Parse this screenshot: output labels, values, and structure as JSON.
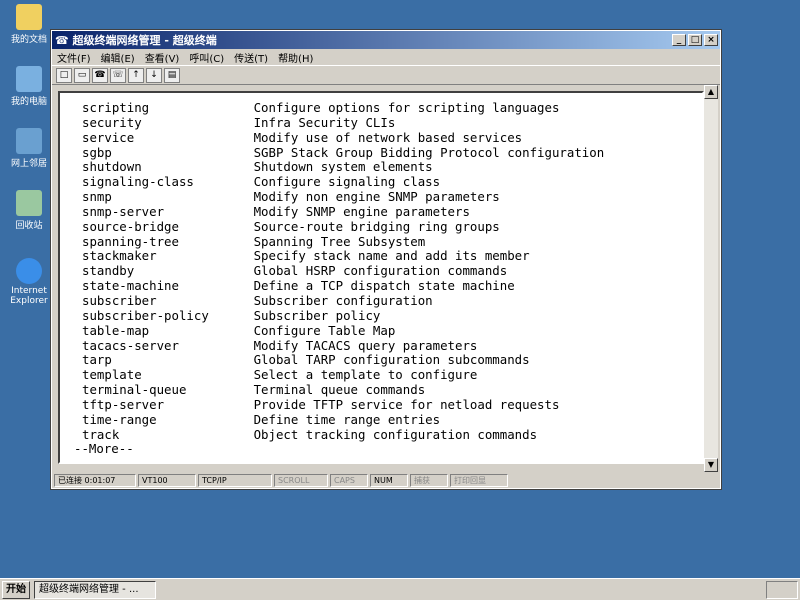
{
  "desktop": {
    "icons": [
      {
        "label": "我的文档",
        "icon": "folder-icon"
      },
      {
        "label": "我的电脑",
        "icon": "computer-icon"
      },
      {
        "label": "网上邻居",
        "icon": "network-icon"
      },
      {
        "label": "回收站",
        "icon": "recycle-bin-icon"
      },
      {
        "label": "Internet Explorer",
        "icon": "ie-icon"
      }
    ]
  },
  "window": {
    "title": "超级终端网络管理 - 超级终端",
    "menu": [
      "文件(F)",
      "编辑(E)",
      "查看(V)",
      "呼叫(C)",
      "传送(T)",
      "帮助(H)"
    ],
    "terminal": {
      "lines": [
        "scripting              Configure options for scripting languages",
        "security               Infra Security CLIs",
        "service                Modify use of network based services",
        "sgbp                   SGBP Stack Group Bidding Protocol configuration",
        "shutdown               Shutdown system elements",
        "signaling-class        Configure signaling class",
        "snmp                   Modify non engine SNMP parameters",
        "snmp-server            Modify SNMP engine parameters",
        "source-bridge          Source-route bridging ring groups",
        "spanning-tree          Spanning Tree Subsystem",
        "stackmaker             Specify stack name and add its member",
        "standby                Global HSRP configuration commands",
        "state-machine          Define a TCP dispatch state machine",
        "subscriber             Subscriber configuration",
        "subscriber-policy      Subscriber policy",
        "table-map              Configure Table Map",
        "tacacs-server          Modify TACACS query parameters",
        "tarp                   Global TARP configuration subcommands",
        "template               Select a template to configure",
        "terminal-queue         Terminal queue commands",
        "tftp-server            Provide TFTP service for netload requests",
        "time-range             Define time range entries",
        "track                  Object tracking configuration commands"
      ],
      "more": "--More--"
    },
    "status": {
      "connected": "已连接 0:01:07",
      "emulation": "VT100",
      "protocol": "TCP/IP",
      "scroll": "SCROLL",
      "caps": "CAPS",
      "num": "NUM",
      "capture": "捕获",
      "echo": "打印回显"
    }
  },
  "taskbar": {
    "start": "开始",
    "task": "超级终端网络管理 - ..."
  }
}
